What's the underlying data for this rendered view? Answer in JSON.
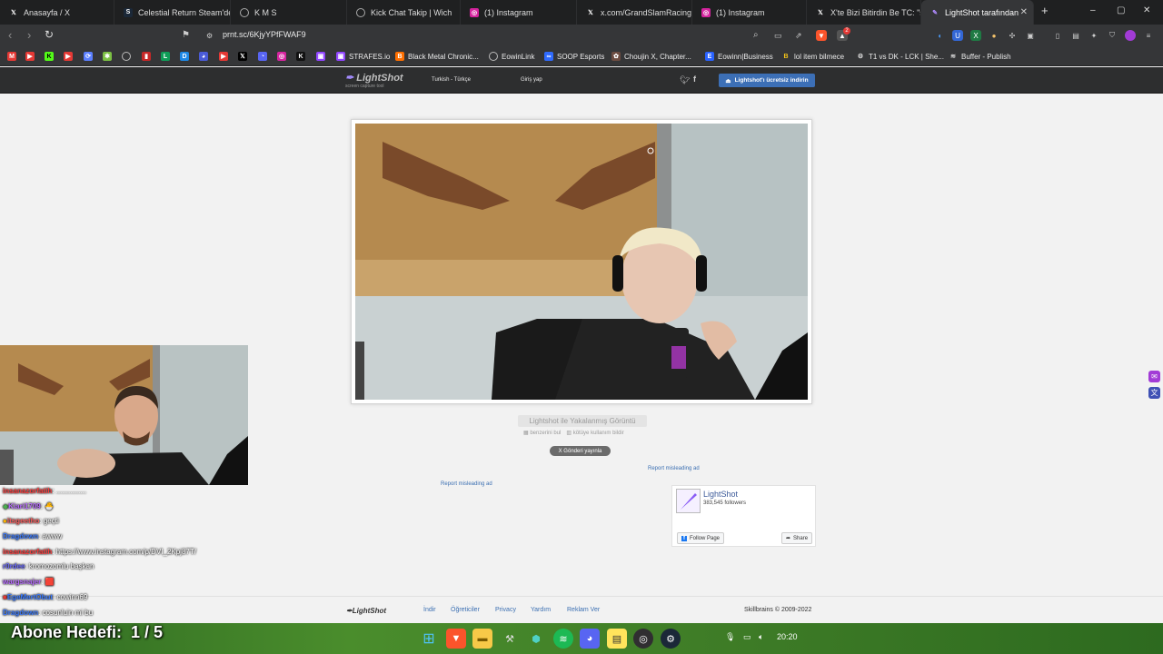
{
  "browser": {
    "tabs": [
      {
        "title": "Anasayfa / X",
        "icon": "x-logo-icon"
      },
      {
        "title": "Celestial Return Steam'de",
        "icon": "steam-icon"
      },
      {
        "title": "K M S",
        "icon": "globe-icon"
      },
      {
        "title": "Kick Chat Takip | Wich",
        "icon": "globe-icon"
      },
      {
        "title": "(1) Instagram",
        "icon": "instagram-icon"
      },
      {
        "title": "x.com/GrandSlamRacing/s",
        "icon": "x-logo-icon"
      },
      {
        "title": "(1) Instagram",
        "icon": "instagram-icon"
      },
      {
        "title": "X'te Bizi Bitirdin Be TC: \"sa",
        "icon": "x-logo-icon"
      },
      {
        "title": "LightShot tarafından",
        "icon": "lightshot-icon",
        "active": true
      }
    ],
    "new_tab": "+",
    "window_controls": [
      "–",
      "▢",
      "✕"
    ],
    "url": "prnt.sc/6KjyYPfFWAF9",
    "notification_badge": "2",
    "bookmarks": [
      {
        "label": "STRAFES.io",
        "icon": "twitch-icon"
      },
      {
        "label": "Black Metal Chronic...",
        "icon": "blogger-icon"
      },
      {
        "label": "EowinLink",
        "icon": "globe-icon"
      },
      {
        "label": "SOOP Esports",
        "icon": "soop-icon"
      },
      {
        "label": "Choujin X, Chapter...",
        "icon": "manga-icon"
      },
      {
        "label": "Eowinn|Business",
        "icon": "business-icon"
      },
      {
        "label": "lol item bilmece",
        "icon": "bookmark-b-icon"
      },
      {
        "label": "T1 vs DK - LCK | She...",
        "icon": "esports-icon"
      },
      {
        "label": "Buffer - Publish",
        "icon": "buffer-icon"
      }
    ]
  },
  "lightshot": {
    "logo": "LightShot",
    "tagline": "screen capture tool",
    "language": "Turkish - Türkçe",
    "login": "Giriş yap",
    "download_button": "Lightshot'ı ücretsiz indirin",
    "caption": "Lightshot ile Yakalanmış Görüntü",
    "similar_link": "benzerini bul",
    "report_link": "kötüye kullanım bildir",
    "post_button": "X Gönderi yayınla",
    "report_ad_1": "Report misleading ad",
    "report_ad_2": "Report misleading ad",
    "fb": {
      "name": "LightShot",
      "followers": "383,545 followers",
      "follow": "Follow Page",
      "share": "Share"
    },
    "footer": {
      "logo": "LightShot",
      "links": [
        "İndir",
        "Öğreticiler",
        "Privacy",
        "Yardım",
        "Reklam Ver"
      ],
      "copyright": "Skillbrains © 2009-2022"
    }
  },
  "stream_overlay": {
    "chat": [
      {
        "user": "insanazorfatih",
        "msg": ": ...............",
        "color": "#ff3b3b"
      },
      {
        "user": "Kiari1709",
        "msg": ": 🐣",
        "color": "#b86bff"
      },
      {
        "user": "itsgeetho",
        "msg": ": geçti",
        "color": "#ff5e5e"
      },
      {
        "user": "Dragdown",
        "msg": ": awww",
        "color": "#3b7bff"
      },
      {
        "user": "insanazorfatih",
        "msg": ": https://www.instagram.com/p/DVI_2Kpj87T/",
        "color": "#ff3b3b"
      },
      {
        "user": "r0rdee",
        "msg": ": kromozomlu başkan",
        "color": "#6b6bff"
      },
      {
        "user": "wargsnajer",
        "msg": ": 🟥",
        "color": "#b86bff"
      },
      {
        "user": "EgeMertObut",
        "msg": ": cowinn69",
        "color": "#3b7bff"
      },
      {
        "user": "Dragdown",
        "msg": ": cosunluin mi bu",
        "color": "#3b7bff"
      }
    ],
    "goal_label": "Abone Hedefi:",
    "goal_value": "1 / 5"
  },
  "taskbar": {
    "apps": [
      "windows-start-icon",
      "brave-icon",
      "file-explorer-icon",
      "tools-icon",
      "vpn-icon",
      "spotify-icon",
      "discord-icon",
      "sticky-notes-icon",
      "obs-icon",
      "steam-icon"
    ],
    "time": "20:20"
  }
}
